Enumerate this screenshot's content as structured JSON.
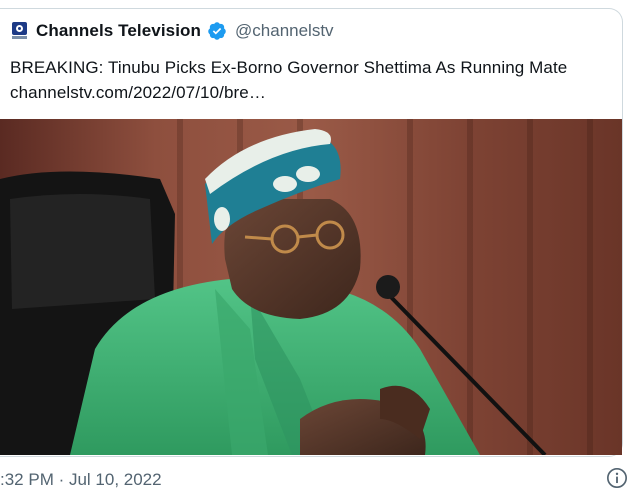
{
  "tweet": {
    "author_name": "Channels Television",
    "handle": "@channelstv",
    "headline": "BREAKING: Tinubu Picks Ex-Borno Governor Shettima As Running Mate",
    "link_text": "channelstv.com/2022/07/10/bre…",
    "timestamp": ":32 PM · Jul 10, 2022"
  },
  "icons": {
    "verified": "verified-badge-icon",
    "avatar": "channels-logo",
    "info": "info-icon",
    "microphone": "microphone"
  },
  "colors": {
    "verified_blue": "#1d9bf0",
    "secondary_text": "#536471",
    "gown_green": "#3fae6e",
    "cap_teal": "#1f7f94",
    "curtain_brown": "#8a4b3a"
  }
}
